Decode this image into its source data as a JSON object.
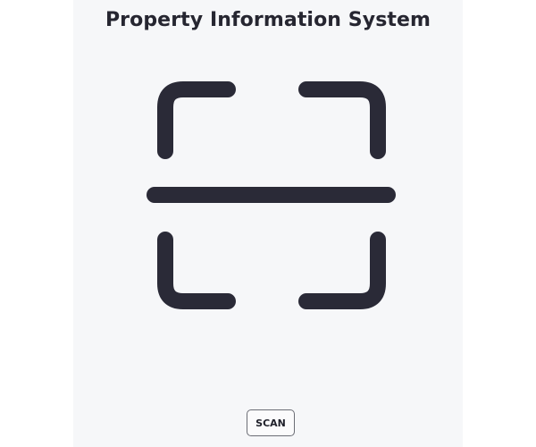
{
  "header": {
    "title": "Property Information System"
  },
  "scanner": {
    "icon": "scan-frame-icon",
    "color": "#2a2a37"
  },
  "actions": {
    "scan_label": "SCAN"
  }
}
